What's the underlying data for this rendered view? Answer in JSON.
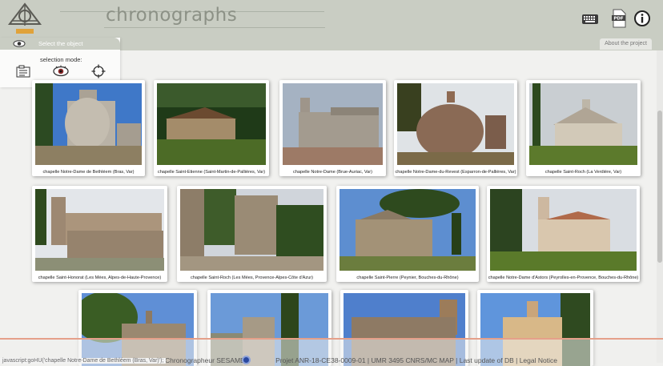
{
  "header": {
    "title": "chronographs",
    "logo_label": "chronograph"
  },
  "select_panel": {
    "title": "Select the object",
    "mode_label": "selection mode:"
  },
  "about_tab": "About the project",
  "cards": [
    {
      "caption": "chapelle Notre-Dame de Bethléem (Bras, Var)"
    },
    {
      "caption": "chapelle Saint-Étienne (Saint-Martin-de-Pallières, Var)"
    },
    {
      "caption": "chapelle Notre-Dame (Brue-Auriac, Var)"
    },
    {
      "caption": "chapelle Notre-Dame-du-Revest (Esparron-de-Pallières, Var)"
    },
    {
      "caption": "chapelle Saint-Roch (La Verdière, Var)"
    },
    {
      "caption": "chapelle Saint-Honorat (Les Mées, Alpes-de-Haute-Provence)"
    },
    {
      "caption": "chapelle Saint-Roch (Les Mées, Provence-Alpes-Côte d'Azur)"
    },
    {
      "caption": "chapelle Saint-Pierre (Peynier, Bouches-du-Rhône)"
    },
    {
      "caption": "chapelle Notre-Dame d'Astors (Peyrolles-en-Provence, Bouches-du-Rhône)"
    },
    {
      "caption": ""
    },
    {
      "caption": ""
    },
    {
      "caption": ""
    },
    {
      "caption": ""
    }
  ],
  "footer": {
    "text_left": "Chronographeur SESAMES",
    "text_right": "Projet ANR-18-CE38-0009-01 | UMR 3495 CNRS/MC MAP | Last update of DB | Legal Notice"
  },
  "status_url": "javascript:goHU('chapelle Notre-Dame de Bethléem (Bras, Var)');",
  "colors": {
    "header_bg": "#c9cdc3",
    "footer_accent": "#e5a08a",
    "page_bg": "#f1f1ef"
  },
  "icons": [
    "keyboard-icon",
    "pdf-icon",
    "info-icon",
    "eye-icon",
    "list-icon",
    "target-icon"
  ]
}
